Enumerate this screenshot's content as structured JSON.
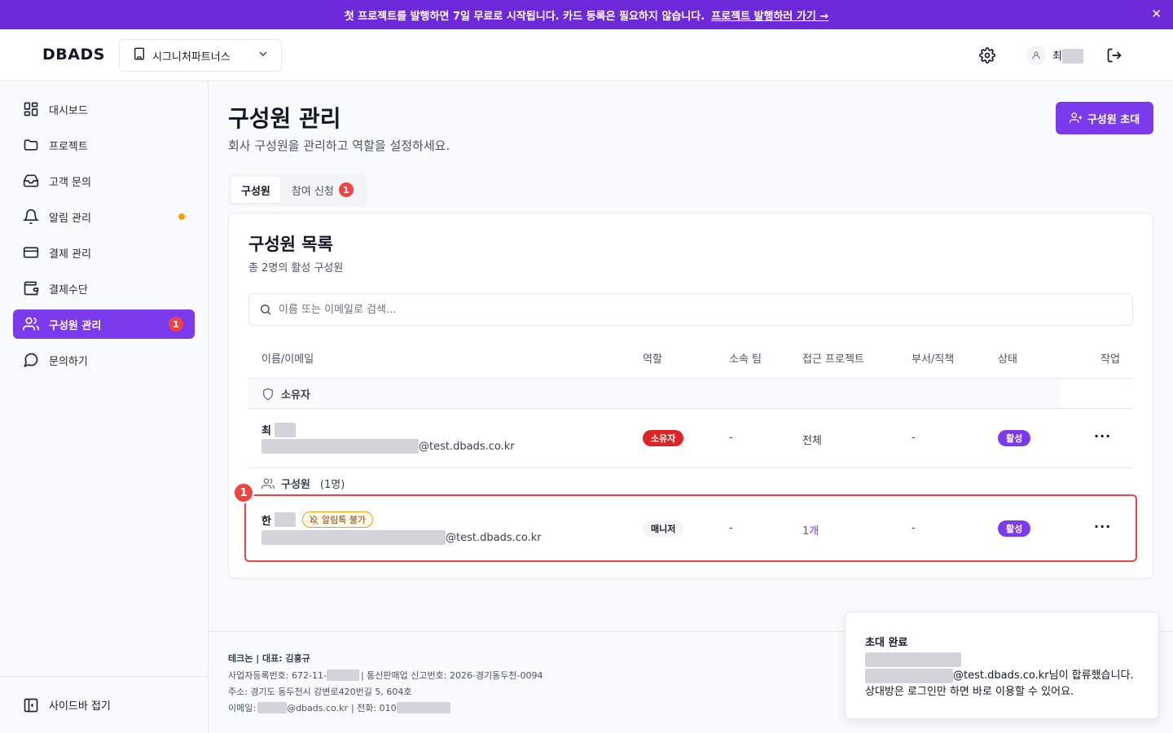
{
  "banner": {
    "text": "첫 프로젝트를 발행하면 7일 무료로 시작됩니다. 카드 등록은 필요하지 않습니다.",
    "link": "프로젝트 발행하러 가기 →",
    "close": "✕"
  },
  "header": {
    "logo": "DBADS",
    "company": "시그니처파트너스",
    "user_initial": "최"
  },
  "sidebar": {
    "items": [
      {
        "label": "대시보드"
      },
      {
        "label": "프로젝트"
      },
      {
        "label": "고객 문의"
      },
      {
        "label": "알림 관리"
      },
      {
        "label": "결제 관리"
      },
      {
        "label": "결제수단"
      },
      {
        "label": "구성원 관리",
        "badge": "1"
      },
      {
        "label": "문의하기"
      }
    ],
    "collapse": "사이드바 접기"
  },
  "page": {
    "title": "구성원 관리",
    "subtitle": "회사 구성원을 관리하고 역할을 설정하세요.",
    "invite_button": "구성원 초대"
  },
  "tabs": [
    {
      "label": "구성원"
    },
    {
      "label": "참여 신청",
      "badge": "1"
    }
  ],
  "members": {
    "title": "구성원 목록",
    "subtitle": "총 2명의 활성 구성원",
    "search_placeholder": "이름 또는 이메일로 검색...",
    "columns": [
      "이름/이메일",
      "역할",
      "소속 팀",
      "접근 프로젝트",
      "부서/직책",
      "상태",
      "작업"
    ],
    "groups": {
      "owner": "소유자",
      "member": "구성원",
      "member_count": "(1명)"
    },
    "rows": [
      {
        "name": "최",
        "email_domain": "@test.dbads.co.kr",
        "role": "소유자",
        "team": "-",
        "projects": "전체",
        "department": "-",
        "status": "활성",
        "more": "···"
      },
      {
        "name": "한",
        "alim_badge": "알림톡 불가",
        "email_domain": "@test.dbads.co.kr",
        "role": "매니저",
        "team": "-",
        "projects": "1개",
        "department": "-",
        "status": "활성",
        "more": "···"
      }
    ]
  },
  "highlight_number": "1",
  "footer": {
    "company": "테크논 | 대표: 김홍규",
    "business_prefix": "사업자등록번호: 672-11-",
    "business_suffix": "| 통신판매업 신고번호: 2026-경기동두천-0094",
    "address": "주소: 경기도 동두천시 강변로420번길 5, 604호",
    "email_prefix": "이메일:",
    "email_domain": "@dbads.co.kr",
    "phone_prefix": "| 전화: 010"
  },
  "toast": {
    "title": "초대 완료",
    "domain": "@test.dbads.co.kr",
    "message": "님이 합류했습니다. 상대방은 로그인만 하면 바로 이용할 수 있어요."
  },
  "colors": {
    "accent": "#7c3aed",
    "banner": "#6d28d9",
    "danger": "#ef4444",
    "warning": "#f59e0b"
  }
}
